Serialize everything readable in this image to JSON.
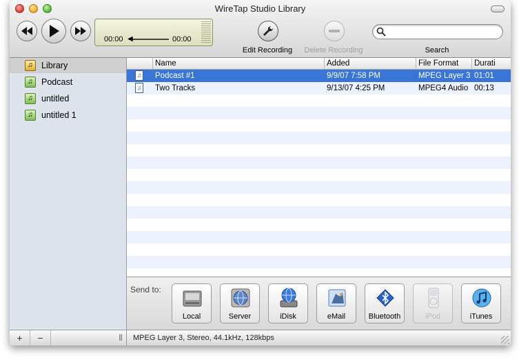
{
  "window": {
    "title": "WireTap Studio Library"
  },
  "player": {
    "elapsed": "00:00",
    "remaining": "00:00",
    "progress_fraction": 0.0
  },
  "toolbar": {
    "edit_label": "Edit Recording",
    "delete_label": "Delete Recording",
    "search_label": "Search",
    "search_value": "",
    "search_placeholder": ""
  },
  "sidebar": {
    "items": [
      {
        "label": "Library",
        "icon": "library-icon",
        "selected": true
      },
      {
        "label": "Podcast",
        "icon": "playlist-icon",
        "selected": false
      },
      {
        "label": "untitled",
        "icon": "playlist-icon",
        "selected": false
      },
      {
        "label": "untitled 1",
        "icon": "playlist-icon",
        "selected": false
      }
    ],
    "add_label": "+",
    "remove_label": "−",
    "grip_label": "|||"
  },
  "table": {
    "columns": [
      "Name",
      "Added",
      "File Format",
      "Durati"
    ],
    "rows": [
      {
        "name": "Podcast #1",
        "added": "9/9/07 7:58 PM",
        "format": "MPEG Layer 3",
        "duration": "01:01",
        "selected": true
      },
      {
        "name": "Two Tracks",
        "added": "9/13/07 4:25 PM",
        "format": "MPEG4 Audio",
        "duration": "00:13",
        "selected": false
      }
    ]
  },
  "sendto": {
    "label": "Send to:",
    "targets": [
      {
        "label": "Local",
        "icon": "hard-drive-icon",
        "enabled": true
      },
      {
        "label": "Server",
        "icon": "server-icon",
        "enabled": true
      },
      {
        "label": "iDisk",
        "icon": "idisk-icon",
        "enabled": true
      },
      {
        "label": "eMail",
        "icon": "email-icon",
        "enabled": true
      },
      {
        "label": "Bluetooth",
        "icon": "bluetooth-icon",
        "enabled": true
      },
      {
        "label": "iPod",
        "icon": "ipod-icon",
        "enabled": false
      },
      {
        "label": "iTunes",
        "icon": "itunes-icon",
        "enabled": true
      }
    ]
  },
  "status": {
    "text": "MPEG Layer 3, Stereo, 44.1kHz, 128kbps"
  },
  "colors": {
    "selection": "#3875d7",
    "stripe": "#edf3fe",
    "sidebar": "#dde3ea"
  }
}
